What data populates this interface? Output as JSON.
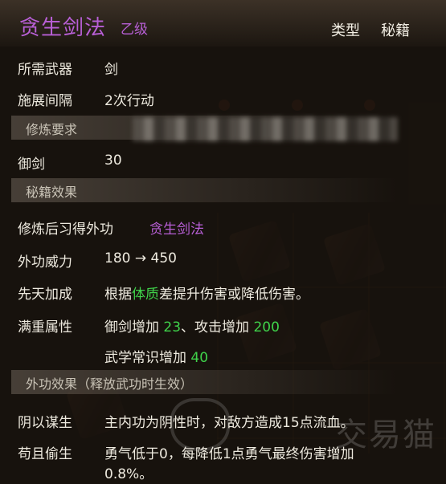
{
  "skill": {
    "name": "贪生剑法",
    "grade": "乙级",
    "type_label": "类型",
    "type_value": "秘籍"
  },
  "rows": {
    "weapon": {
      "label": "所需武器",
      "value": "剑"
    },
    "interval": {
      "label": "施展间隔",
      "value": "2次行动"
    },
    "train_req_header": "修炼要求",
    "sword": {
      "label": "御剑",
      "value": "30"
    },
    "book_effect_header": "秘籍效果",
    "learn": {
      "label": "修炼后习得外功",
      "value": "贪生剑法"
    },
    "power": {
      "label": "外功威力",
      "value": "180 → 450"
    },
    "innate": {
      "label": "先天加成",
      "pre": "根据",
      "highlight": "体质",
      "post": "差提升伤害或降低伤害。"
    },
    "full": {
      "label": "满重属性",
      "line1_a": "御剑增加",
      "line1_a_val": "23",
      "line1_sep": "、攻击增加",
      "line1_b_val": "200",
      "line2_a": "武学常识增加",
      "line2_a_val": "40"
    },
    "ext_effect_header": "外功效果（释放武功时生效）",
    "yin": {
      "label": "阴以谋生",
      "value": "主内功为阴性时，对敌方造成15点流血。"
    },
    "gou": {
      "label": "苟且偷生",
      "line1": "勇气低于0，每降低1点勇气最终伤害增加",
      "line2": "0.8%。"
    }
  },
  "watermark": "交易猫",
  "colors": {
    "purple": "#b85fd6",
    "green": "#3fd24a",
    "text": "#eeeadf"
  }
}
